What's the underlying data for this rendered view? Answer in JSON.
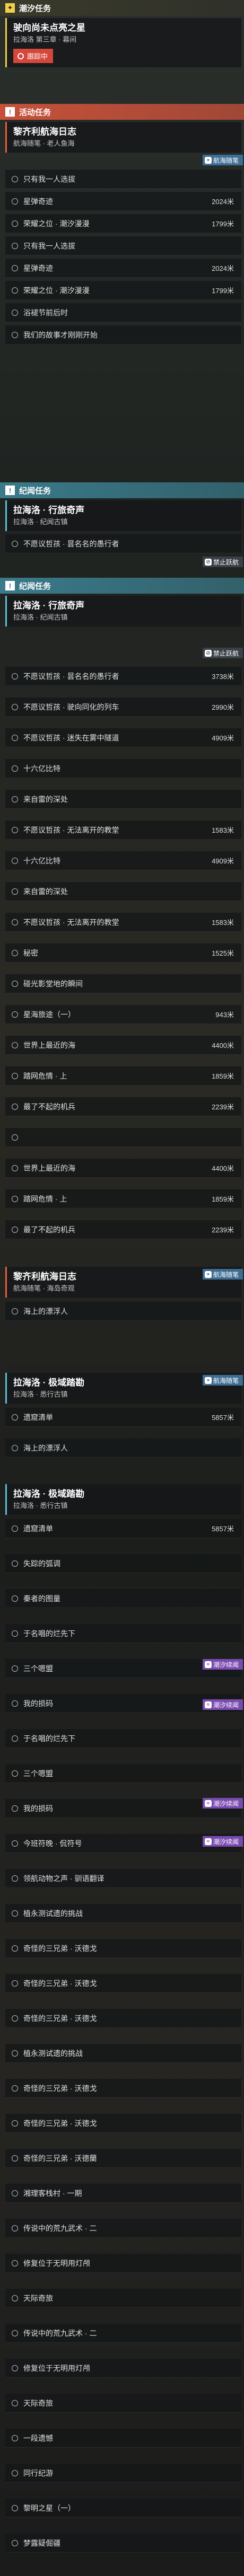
{
  "sections": {
    "chaoxi": {
      "icon": "✦",
      "label": "潮汐任务"
    },
    "activity": {
      "icon": "!",
      "label": "活动任务"
    },
    "jiwen": {
      "icon": "!",
      "label": "纪闻任务"
    }
  },
  "quest1": {
    "title": "驶向尚未点亮之星",
    "sub": "拉海洛 第三章 · 幕间",
    "track": "跟踪中"
  },
  "quest2": {
    "title": "黎齐利航海日志",
    "sub": "航海随笔 · 老人鱼海",
    "tag": "航海随笔"
  },
  "q2objs": [
    {
      "text": "只有我一人选拔",
      "dist": ""
    },
    {
      "text": "星弹奇迹",
      "dist": "2024米"
    },
    {
      "text": "荣耀之位 · 潮汐漫漫",
      "dist": "1799米"
    },
    {
      "text": "只有我一人选拔",
      "dist": ""
    },
    {
      "text": "星弹奇迹",
      "dist": "2024米"
    },
    {
      "text": "荣耀之位 · 潮汐漫漫",
      "dist": "1799米"
    },
    {
      "text": "浴褪节前后时",
      "dist": ""
    },
    {
      "text": "我们的故事才刚刚开始",
      "dist": ""
    }
  ],
  "quest3": {
    "title": "拉海洛 · 行旅奇声",
    "sub": "拉海洛 · 纪闻古镇",
    "tag": "禁止跃航"
  },
  "q3objs": [
    {
      "text": "不愿议哲孩 · 昙名名的愚行者",
      "dist": ""
    }
  ],
  "quest4": {
    "title": "拉海洛 · 行旅奇声",
    "sub": "拉海洛 · 纪闻古镇",
    "tag": "禁止跃航"
  },
  "q4objs": [
    {
      "text": "不愿议哲孩 · 昙名名的愚行者",
      "dist": "3738米"
    },
    {
      "text": "不愿议哲孩 · 驶向同化的列车",
      "dist": "2990米"
    },
    {
      "text": "不愿议哲孩 · 迷失在雾中隧道",
      "dist": "4909米"
    },
    {
      "text": "十六亿比特",
      "dist": ""
    },
    {
      "text": "来自雷的深处",
      "dist": ""
    },
    {
      "text": "不愿议哲孩 · 无法离开的教堂",
      "dist": "1583米"
    },
    {
      "text": "十六亿比特",
      "dist": "4909米"
    },
    {
      "text": "来自雷的深处",
      "dist": ""
    },
    {
      "text": "不愿议哲孩 · 无法离开的教堂",
      "dist": "1583米"
    },
    {
      "text": "秘密",
      "dist": "1525米"
    },
    {
      "text": "碰光影堂地的瞬间",
      "dist": ""
    },
    {
      "text": "星海旅途（一）",
      "dist": "943米"
    },
    {
      "text": "世界上最近的海",
      "dist": "4400米"
    },
    {
      "text": "踏网危情 · 上",
      "dist": "1859米"
    },
    {
      "text": "最了不起的机兵",
      "dist": "2239米"
    },
    {
      "text": "",
      "dist": ""
    },
    {
      "text": "世界上最近的海",
      "dist": "4400米"
    },
    {
      "text": "踏网危情 · 上",
      "dist": "1859米"
    },
    {
      "text": "最了不起的机兵",
      "dist": "2239米"
    }
  ],
  "quest5": {
    "title": "黎齐利航海日志",
    "sub": "航海随笔 · 海岛奇观",
    "tag": "航海随笔"
  },
  "q5objs": [
    {
      "text": "海上的漂浮人",
      "dist": ""
    }
  ],
  "quest6": {
    "title": "拉海洛 · 极域踏勘",
    "sub": "拉海洛 · 悉行古镇",
    "tag": "航海随笔"
  },
  "q6objs": [
    {
      "text": "遗窟清单",
      "dist": "5857米"
    },
    {
      "text": "海上的漂浮人",
      "dist": ""
    }
  ],
  "quest7": {
    "title": "拉海洛 · 极域踏勘",
    "sub": "拉海洛 · 悉行古镇"
  },
  "q7objs": [
    {
      "text": "遗窟清单",
      "dist": "5857米"
    },
    {
      "text": "失踪的弧调",
      "dist": ""
    },
    {
      "text": "秦者的图量",
      "dist": ""
    },
    {
      "text": "于名唱的烂先下",
      "dist": ""
    },
    {
      "text": "三个嗯盟",
      "dist": ""
    },
    {
      "text": "我的损码",
      "dist": ""
    },
    {
      "text": "于名唱的烂先下",
      "dist": ""
    },
    {
      "text": "三个嗯盟",
      "dist": ""
    },
    {
      "text": "我的损码",
      "dist": ""
    },
    {
      "text": "今班符晚 · 侃符号",
      "dist": ""
    },
    {
      "text": "领航动物之声 · 驯语翻译",
      "dist": ""
    },
    {
      "text": "植永测试遗的挑战",
      "dist": ""
    },
    {
      "text": "奇怪的三兄弟 · 沃德戈",
      "dist": ""
    },
    {
      "text": "奇怪的三兄弟 · 沃德戈",
      "dist": ""
    },
    {
      "text": "奇怪的三兄弟 · 沃德戈",
      "dist": ""
    },
    {
      "text": "植永测试遗的挑战",
      "dist": ""
    },
    {
      "text": "奇怪的三兄弟 · 沃德戈",
      "dist": ""
    },
    {
      "text": "奇怪的三兄弟 · 沃德戈",
      "dist": ""
    },
    {
      "text": "奇怪的三兄弟 · 沃德蘭",
      "dist": ""
    },
    {
      "text": "湘理客栈村 · 一期",
      "dist": ""
    },
    {
      "text": "传说中的荒九武术 · 二",
      "dist": ""
    },
    {
      "text": "修复位于无明用灯颅",
      "dist": ""
    },
    {
      "text": "天际奇旅",
      "dist": ""
    },
    {
      "text": "传说中的荒九武术 · 二",
      "dist": ""
    },
    {
      "text": "修复位于无明用灯颅",
      "dist": ""
    },
    {
      "text": "天际奇旅",
      "dist": ""
    },
    {
      "text": "一段遗憾",
      "dist": ""
    },
    {
      "text": "同行纪游",
      "dist": ""
    },
    {
      "text": "黎明之星（一）",
      "dist": ""
    },
    {
      "text": "梦露疑倔疆",
      "dist": ""
    }
  ],
  "tags": {
    "chaoxi": "潮汐续闻",
    "jinzhi": "禁止跃航"
  }
}
